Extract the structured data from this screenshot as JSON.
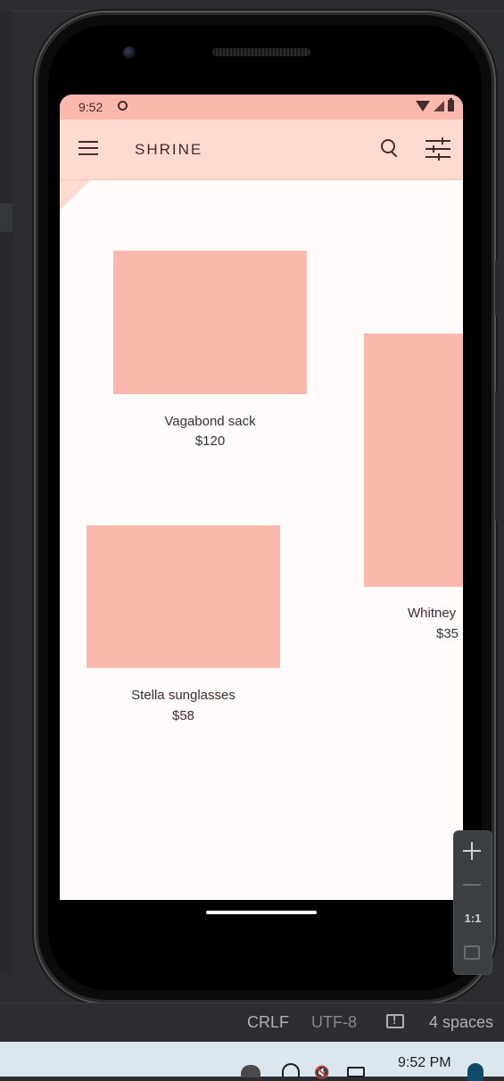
{
  "device": {
    "status_bar": {
      "time": "9:52"
    },
    "home_indicator": "home-bar"
  },
  "app": {
    "title": "SHRINE",
    "icons": [
      "menu-icon",
      "search-icon",
      "tune-icon"
    ],
    "colors": {
      "primary": "#fedbd0",
      "status": "#fbb8ac",
      "surface": "#fffbfa",
      "on_surface": "#442c2e"
    }
  },
  "products": [
    {
      "name": "Vagabond sack",
      "price": "$120"
    },
    {
      "name": "Whitney",
      "price": "$35"
    },
    {
      "name": "Stella sunglasses",
      "price": "$58"
    }
  ],
  "emulator_controls": {
    "zoom_in": "+",
    "zoom_out": "—",
    "actual_size": "1:1"
  },
  "ide_status": {
    "line_separator": "CRLF",
    "encoding": "UTF-8",
    "indent": "4 spaces"
  },
  "taskbar": {
    "clock": "9:52 PM"
  }
}
